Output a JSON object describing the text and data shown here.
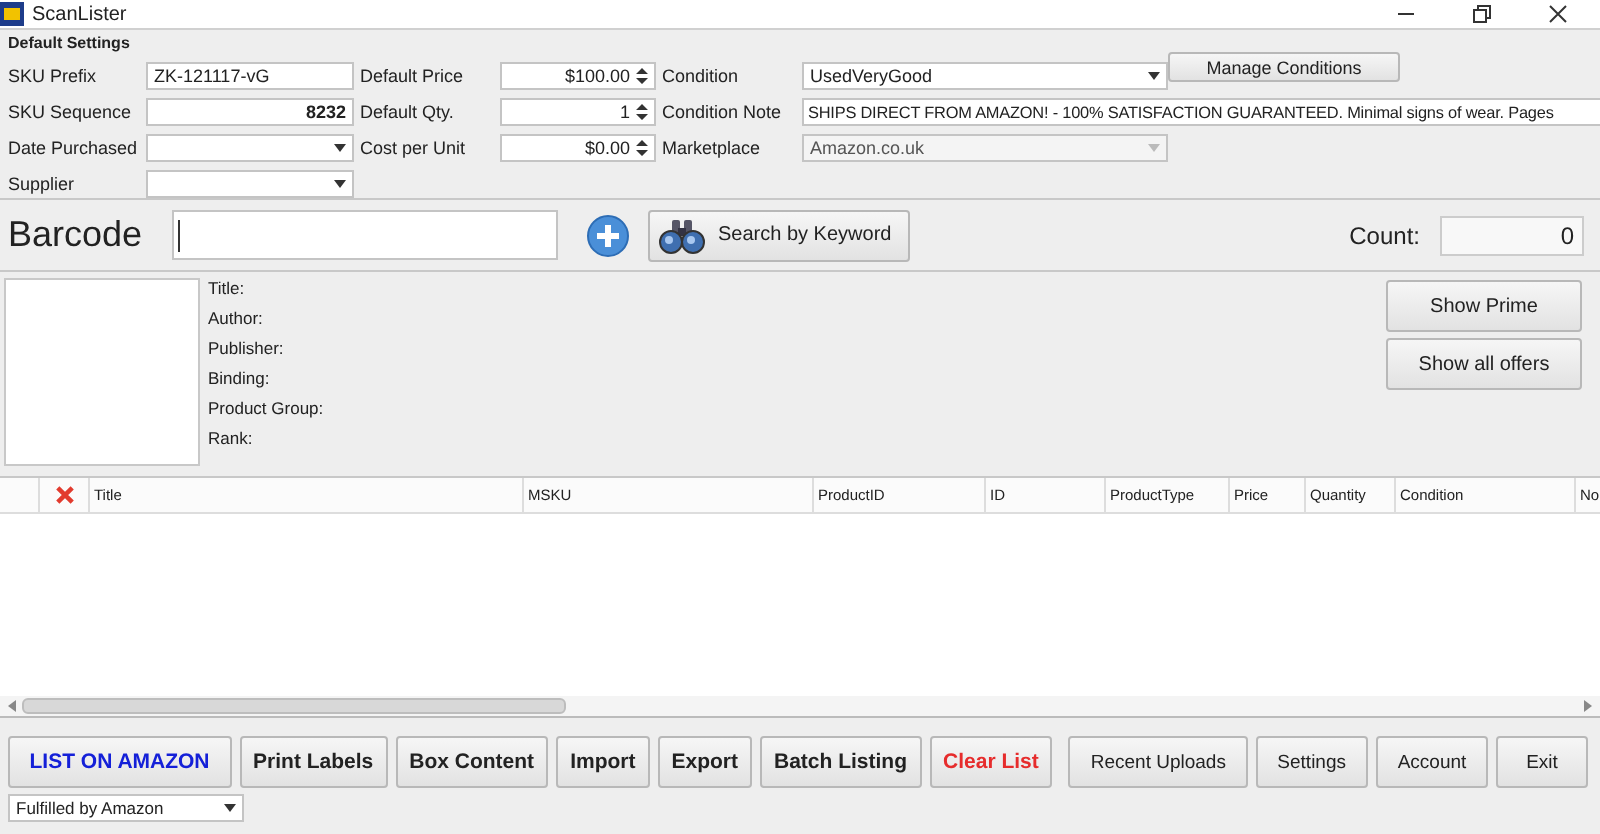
{
  "window": {
    "title": "ScanLister"
  },
  "default_settings": {
    "heading": "Default Settings",
    "columns": [
      [
        {
          "label": "SKU Prefix",
          "kind": "text",
          "value": "ZK-121117-vG"
        },
        {
          "label": "SKU Sequence",
          "kind": "number",
          "value": "8232"
        },
        {
          "label": "Date Purchased",
          "kind": "dropdown",
          "disabled": false
        },
        {
          "label": "Supplier",
          "kind": "dropdown",
          "disabled": false
        }
      ],
      [
        {
          "label": "Default Price",
          "kind": "spinner",
          "value": "$100.00"
        },
        {
          "label": "Default Qty.",
          "kind": "spinner",
          "value": "1"
        },
        {
          "label": "Cost per Unit",
          "kind": "spinner",
          "value": "$0.00"
        }
      ],
      [
        {
          "label": "Condition",
          "kind": "dropdown",
          "value": "UsedVeryGood",
          "disabled": false
        },
        {
          "label": "Condition Note",
          "kind": "text",
          "value": "SHIPS DIRECT FROM AMAZON! - 100% SATISFACTION GUARANTEED. Minimal signs of wear. Pages"
        },
        {
          "label": "Marketplace",
          "kind": "dropdown",
          "value": "Amazon.co.uk",
          "disabled": true
        }
      ]
    ],
    "manage_button": "Manage Conditions"
  },
  "barcode": {
    "label": "Barcode",
    "search_button": "Search by Keyword",
    "count_label": "Count:",
    "count": "0"
  },
  "product_info": {
    "fields": [
      "Title:",
      "Author:",
      "Publisher:",
      "Binding:",
      "Product Group:",
      "Rank:"
    ],
    "buttons": [
      "Show Prime",
      "Show all offers"
    ]
  },
  "table": {
    "columns": [
      "Title",
      "MSKU",
      "ProductID",
      "ID",
      "ProductType",
      "Price",
      "Quantity",
      "Condition",
      "No"
    ]
  },
  "actions": [
    {
      "label": "LIST ON AMAZON",
      "kind": "primary"
    },
    {
      "label": "Print Labels",
      "kind": "bold"
    },
    {
      "label": "Box Content",
      "kind": "bold"
    },
    {
      "label": "Import",
      "kind": "bold"
    },
    {
      "label": "Export",
      "kind": "bold"
    },
    {
      "label": "Batch Listing",
      "kind": "bold"
    },
    {
      "label": "Clear List",
      "kind": "danger"
    }
  ],
  "nav_buttons": [
    "Recent Uploads",
    "Settings",
    "Account",
    "Exit"
  ],
  "fulfillment": {
    "value": "Fulfilled by Amazon"
  }
}
